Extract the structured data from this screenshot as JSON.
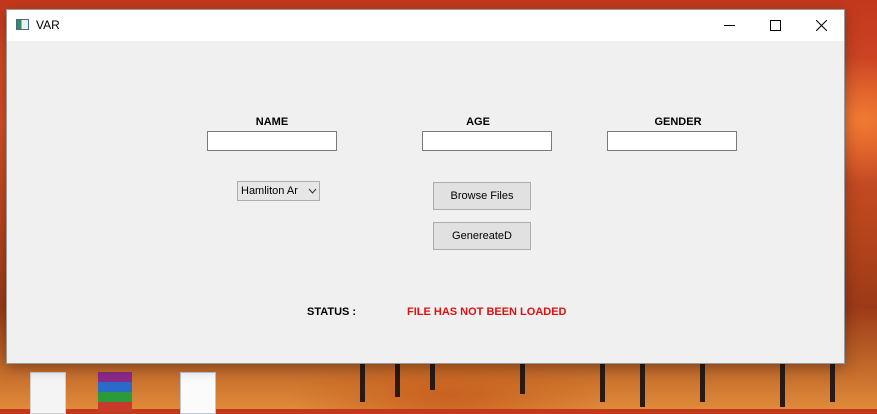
{
  "window": {
    "title": "VAR",
    "minimize_icon": "minimize-icon",
    "maximize_icon": "maximize-icon",
    "close_icon": "close-icon"
  },
  "form": {
    "name_label": "NAME",
    "age_label": "AGE",
    "gender_label": "GENDER",
    "name_value": "",
    "age_value": "",
    "gender_value": "",
    "dropdown_selected": "Hamliton Ar",
    "browse_button": "Browse Files",
    "generate_button": "GenereateD"
  },
  "status": {
    "label": "STATUS :",
    "value": "FILE HAS NOT BEEN LOADED",
    "value_color": "#e01010"
  }
}
